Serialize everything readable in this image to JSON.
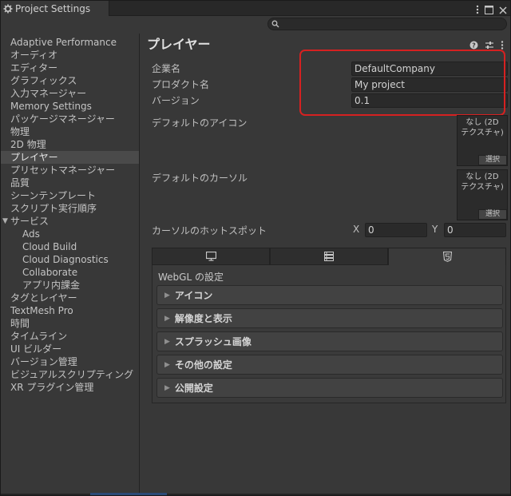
{
  "window": {
    "title": "Project Settings",
    "search_placeholder": ""
  },
  "sidebar": {
    "items": [
      {
        "label": "Adaptive Performance",
        "indent": 0
      },
      {
        "label": "オーディオ",
        "indent": 0
      },
      {
        "label": "エディター",
        "indent": 0
      },
      {
        "label": "グラフィックス",
        "indent": 0
      },
      {
        "label": "入力マネージャー",
        "indent": 0
      },
      {
        "label": "Memory Settings",
        "indent": 0
      },
      {
        "label": "パッケージマネージャー",
        "indent": 0
      },
      {
        "label": "物理",
        "indent": 0
      },
      {
        "label": "2D 物理",
        "indent": 0
      },
      {
        "label": "プレイヤー",
        "indent": 0,
        "selected": true
      },
      {
        "label": "プリセットマネージャー",
        "indent": 0
      },
      {
        "label": "品質",
        "indent": 0
      },
      {
        "label": "シーンテンプレート",
        "indent": 0
      },
      {
        "label": "スクリプト実行順序",
        "indent": 0
      },
      {
        "label": "サービス",
        "indent": 0,
        "expanded": true
      },
      {
        "label": "Ads",
        "indent": 1
      },
      {
        "label": "Cloud Build",
        "indent": 1
      },
      {
        "label": "Cloud Diagnostics",
        "indent": 1
      },
      {
        "label": "Collaborate",
        "indent": 1
      },
      {
        "label": "アプリ内課金",
        "indent": 1
      },
      {
        "label": "タグとレイヤー",
        "indent": 0
      },
      {
        "label": "TextMesh Pro",
        "indent": 0
      },
      {
        "label": "時間",
        "indent": 0
      },
      {
        "label": "タイムライン",
        "indent": 0
      },
      {
        "label": "UI ビルダー",
        "indent": 0
      },
      {
        "label": "バージョン管理",
        "indent": 0
      },
      {
        "label": "ビジュアルスクリプティング",
        "indent": 0
      },
      {
        "label": "XR プラグイン管理",
        "indent": 0
      }
    ]
  },
  "main": {
    "title": "プレイヤー",
    "company_label": "企業名",
    "company_value": "DefaultCompany",
    "product_label": "プロダクト名",
    "product_value": "My project",
    "version_label": "バージョン",
    "version_value": "0.1",
    "default_icon_label": "デフォルトのアイコン",
    "default_cursor_label": "デフォルトのカーソル",
    "none_texture": "なし (2D\nテクスチャ)",
    "select_label": "選択",
    "hotspot_label": "カーソルのホットスポット",
    "hotspot_x_label": "X",
    "hotspot_x_value": "0",
    "hotspot_y_label": "Y",
    "hotspot_y_value": "0",
    "platform_tabs": [
      {
        "icon": "monitor-icon",
        "active": false
      },
      {
        "icon": "server-icon",
        "active": false
      },
      {
        "icon": "html5-icon",
        "active": true
      }
    ],
    "platform_settings_title": "WebGL の設定",
    "sections": [
      "アイコン",
      "解像度と表示",
      "スプラッシュ画像",
      "その他の設定",
      "公開設定"
    ]
  },
  "colors": {
    "highlight_box": "#d62121",
    "background": "#383838",
    "field": "#2a2a2a"
  }
}
